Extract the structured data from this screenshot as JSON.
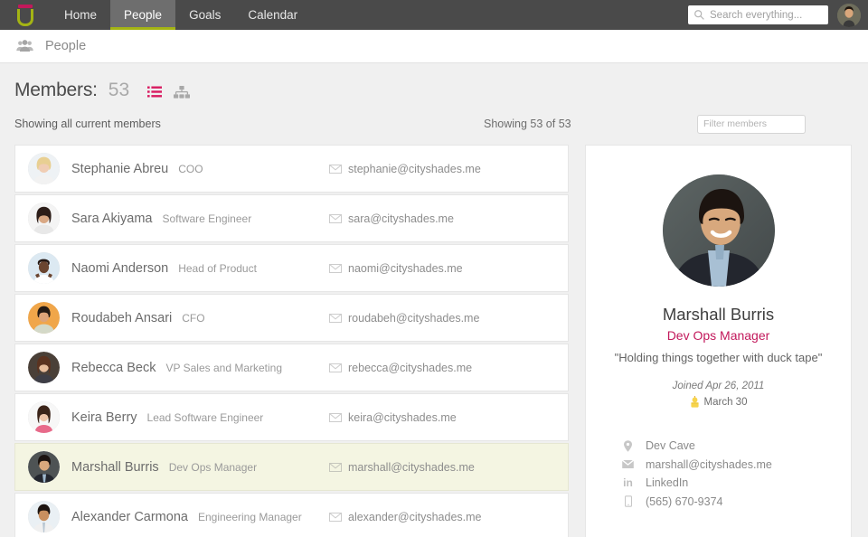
{
  "brand": {
    "logo_icon": "u-logo-icon",
    "accent_olive": "#a4b414",
    "accent_crimson": "#c2185b",
    "nav_bg": "#4a4a4a",
    "page_bg": "#f0f0f0",
    "selected_row_bg": "#f4f5e2"
  },
  "topnav": {
    "items": [
      {
        "label": "Home",
        "active": false
      },
      {
        "label": "People",
        "active": true
      },
      {
        "label": "Goals",
        "active": false
      },
      {
        "label": "Calendar",
        "active": false
      }
    ],
    "search": {
      "placeholder": "Search everything...",
      "value": "",
      "icon": "search-icon"
    },
    "avatar_icon": "user-avatar"
  },
  "breadcrumb": {
    "icon": "people-group-icon",
    "text": "People"
  },
  "header": {
    "members_label": "Members:",
    "members_count": "53",
    "list_view_icon": "list-view-icon",
    "org_view_icon": "org-chart-icon",
    "showing_all": "Showing all current members",
    "showing_count": "Showing 53 of 53",
    "filter": {
      "placeholder": "Filter members",
      "value": ""
    }
  },
  "members": [
    {
      "name": "Stephanie Abreu",
      "title": "COO",
      "email": "stephanie@cityshades.me",
      "selected": false,
      "skin": "#f0cdb4",
      "hair": "#e8cf92",
      "shirt": "#f2f2f2",
      "bg": "#eef2f5"
    },
    {
      "name": "Sara Akiyama",
      "title": "Software Engineer",
      "email": "sara@cityshades.me",
      "selected": false,
      "skin": "#d9a884",
      "hair": "#2c1d18",
      "shirt": "#e8e8e8",
      "bg": "#f4f4f4"
    },
    {
      "name": "Naomi Anderson",
      "title": "Head of Product",
      "email": "naomi@cityshades.me",
      "selected": false,
      "skin": "#6b4530",
      "hair": "#241713",
      "shirt": "#ffffff",
      "bg": "#dce9f2"
    },
    {
      "name": "Roudabeh Ansari",
      "title": "CFO",
      "email": "roudabeh@cityshades.me",
      "selected": false,
      "skin": "#dda479",
      "hair": "#241a14",
      "shirt": "#d4d9c8",
      "bg": "#f0a64a"
    },
    {
      "name": "Rebecca Beck",
      "title": "VP Sales and Marketing",
      "email": "rebecca@cityshades.me",
      "selected": false,
      "skin": "#e8bd9c",
      "hair": "#5b3320",
      "shirt": "#3e3e46",
      "bg": "#4a4038"
    },
    {
      "name": "Keira Berry",
      "title": "Lead Software Engineer",
      "email": "keira@cityshades.me",
      "selected": false,
      "skin": "#eec4a8",
      "hair": "#3b2419",
      "shirt": "#e86a8a",
      "bg": "#f7f7f7"
    },
    {
      "name": "Marshall Burris",
      "title": "Dev Ops Manager",
      "email": "marshall@cityshades.me",
      "selected": true,
      "skin": "#d8a87d",
      "hair": "#1c1410",
      "shirt": "#23262e",
      "bg": "#4e5354"
    },
    {
      "name": "Alexander Carmona",
      "title": "Engineering Manager",
      "email": "alexander@cityshades.me",
      "selected": false,
      "skin": "#c98f5f",
      "hair": "#1d1410",
      "shirt": "#f0f0f0",
      "bg": "#eaf0f4"
    }
  ],
  "detail": {
    "photo_icon": "profile-photo",
    "name": "Marshall Burris",
    "role": "Dev Ops Manager",
    "quote": "\"Holding things together with duck tape\"",
    "joined": "Joined Apr 26, 2011",
    "birthday": "March 30",
    "birthday_icon": "cake-icon",
    "contacts": [
      {
        "icon": "map-pin-icon",
        "text": "Dev Cave"
      },
      {
        "icon": "envelope-icon",
        "text": "marshall@cityshades.me"
      },
      {
        "icon": "linkedin-icon",
        "text": "LinkedIn"
      },
      {
        "icon": "mobile-icon",
        "text": "(565) 670-9374"
      }
    ]
  }
}
